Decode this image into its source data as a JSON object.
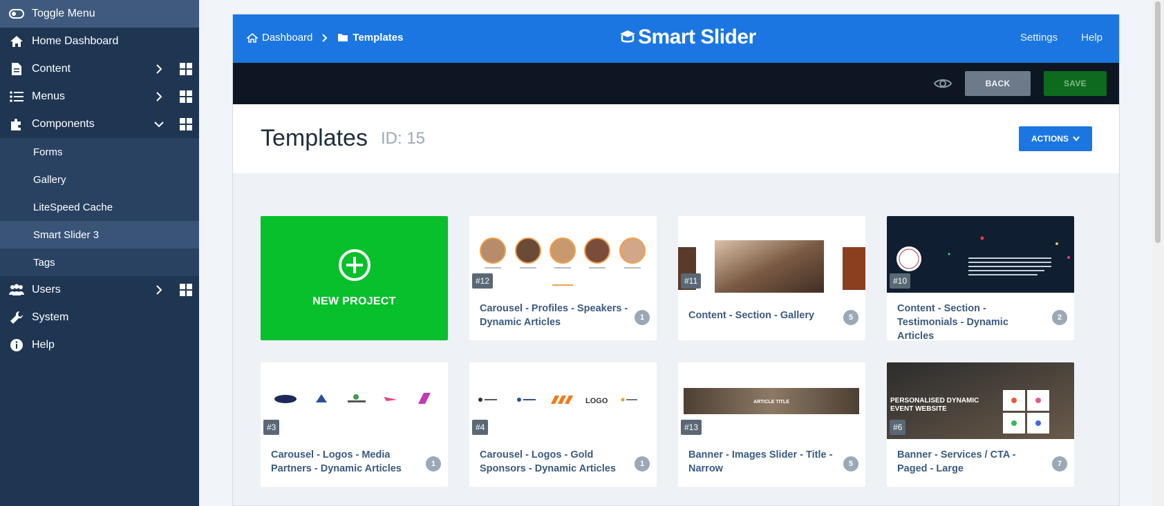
{
  "sidebar": {
    "toggle_label": "Toggle Menu",
    "items": [
      {
        "label": "Home Dashboard"
      },
      {
        "label": "Content"
      },
      {
        "label": "Menus"
      },
      {
        "label": "Components"
      }
    ],
    "sub_items": [
      {
        "label": "Forms"
      },
      {
        "label": "Gallery"
      },
      {
        "label": "LiteSpeed Cache"
      },
      {
        "label": "Smart Slider 3"
      },
      {
        "label": "Tags"
      }
    ],
    "bottom_items": [
      {
        "label": "Users"
      },
      {
        "label": "System"
      },
      {
        "label": "Help"
      }
    ]
  },
  "topbar": {
    "crumb_dashboard": "Dashboard",
    "crumb_templates": "Templates",
    "logo": "Smart Slider",
    "settings": "Settings",
    "help": "Help"
  },
  "toolbar": {
    "back": "BACK",
    "save": "SAVE"
  },
  "header": {
    "title": "Templates",
    "id": "ID: 15",
    "actions": "ACTIONS"
  },
  "new_project": "NEW PROJECT",
  "cards": [
    {
      "id": "#12",
      "title": "Carousel - Profiles - Speakers - Dynamic Articles",
      "count": "1"
    },
    {
      "id": "#11",
      "title": "Content - Section - Gallery",
      "count": "5"
    },
    {
      "id": "#10",
      "title": "Content - Section - Testimonials - Dynamic Articles",
      "count": "2"
    },
    {
      "id": "#3",
      "title": "Carousel - Logos - Media Partners - Dynamic Articles",
      "count": "1"
    },
    {
      "id": "#4",
      "title": "Carousel - Logos - Gold Sponsors - Dynamic Articles",
      "count": "1"
    },
    {
      "id": "#13",
      "title": "Banner - Images Slider - Title - Narrow",
      "count": "5"
    },
    {
      "id": "#6",
      "title": "Banner - Services / CTA - Paged - Large",
      "count": "7"
    }
  ],
  "thumbs": {
    "banner_text": "ARTICLE TITLE",
    "event_text_1": "PERSONALISED DYNAMIC",
    "event_text_2": "EVENT WEBSITE",
    "logo_text": "LOGO"
  },
  "colors": {
    "sidebar": "#1f3653",
    "brand": "#1b76e2",
    "new_project": "#08bf2c",
    "save": "#0d6b1e"
  }
}
